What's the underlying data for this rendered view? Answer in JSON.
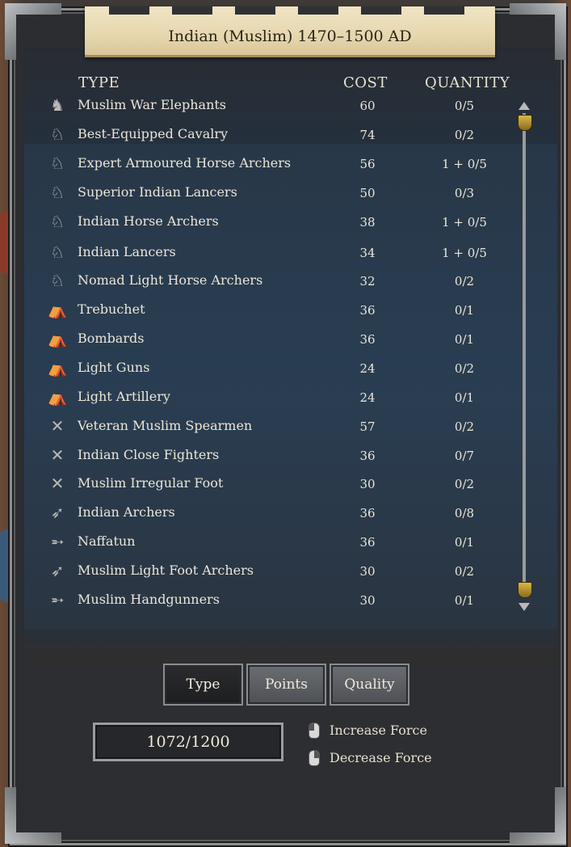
{
  "title": "Indian (Muslim) 1470–1500 AD",
  "headers": {
    "type": "TYPE",
    "cost": "COST",
    "quantity": "QUANTITY"
  },
  "units": [
    {
      "icon": "elephant-icon",
      "glyph": "♞",
      "name": "Muslim War Elephants",
      "cost": "60",
      "qty": "0/5"
    },
    {
      "icon": "cavalry-icon",
      "glyph": "♘",
      "name": "Best-Equipped Cavalry",
      "cost": "74",
      "qty": "0/2"
    },
    {
      "icon": "cavalry-icon",
      "glyph": "♘",
      "name": "Expert Armoured Horse Archers",
      "cost": "56",
      "qty": "1 + 0/5"
    },
    {
      "icon": "cavalry-icon",
      "glyph": "♘",
      "name": "Superior Indian Lancers",
      "cost": "50",
      "qty": "0/3"
    },
    {
      "icon": "cavalry-icon",
      "glyph": "♘",
      "name": "Indian Horse Archers",
      "cost": "38",
      "qty": "1 + 0/5"
    },
    {
      "icon": "cavalry-icon",
      "glyph": "♘",
      "name": "Indian Lancers",
      "cost": "34",
      "qty": "1 + 0/5"
    },
    {
      "icon": "light-cavalry-icon",
      "glyph": "♘",
      "name": "Nomad Light Horse Archers",
      "cost": "32",
      "qty": "0/2"
    },
    {
      "icon": "artillery-icon",
      "glyph": "⛺",
      "name": "Trebuchet",
      "cost": "36",
      "qty": "0/1"
    },
    {
      "icon": "artillery-icon",
      "glyph": "⛺",
      "name": "Bombards",
      "cost": "36",
      "qty": "0/1"
    },
    {
      "icon": "artillery-icon",
      "glyph": "⛺",
      "name": "Light Guns",
      "cost": "24",
      "qty": "0/2"
    },
    {
      "icon": "artillery-icon",
      "glyph": "⛺",
      "name": "Light Artillery",
      "cost": "24",
      "qty": "0/1"
    },
    {
      "icon": "crossed-spears-icon",
      "glyph": "✕",
      "name": "Veteran Muslim Spearmen",
      "cost": "57",
      "qty": "0/2"
    },
    {
      "icon": "crossed-spears-icon",
      "glyph": "✕",
      "name": "Indian Close Fighters",
      "cost": "36",
      "qty": "0/7"
    },
    {
      "icon": "crossed-spears-icon",
      "glyph": "✕",
      "name": "Muslim Irregular Foot",
      "cost": "30",
      "qty": "0/2"
    },
    {
      "icon": "bow-icon",
      "glyph": "➶",
      "name": "Indian Archers",
      "cost": "36",
      "qty": "0/8"
    },
    {
      "icon": "missile-icon",
      "glyph": "➵",
      "name": "Naffatun",
      "cost": "36",
      "qty": "0/1"
    },
    {
      "icon": "bow-icon",
      "glyph": "➶",
      "name": "Muslim Light Foot Archers",
      "cost": "30",
      "qty": "0/2"
    },
    {
      "icon": "gun-icon",
      "glyph": "➵",
      "name": "Muslim Handgunners",
      "cost": "30",
      "qty": "0/1"
    }
  ],
  "sort_buttons": {
    "type": "Type",
    "points": "Points",
    "quality": "Quality"
  },
  "points": "1072/1200",
  "hints": {
    "increase": "Increase Force",
    "decrease": "Decrease Force"
  }
}
